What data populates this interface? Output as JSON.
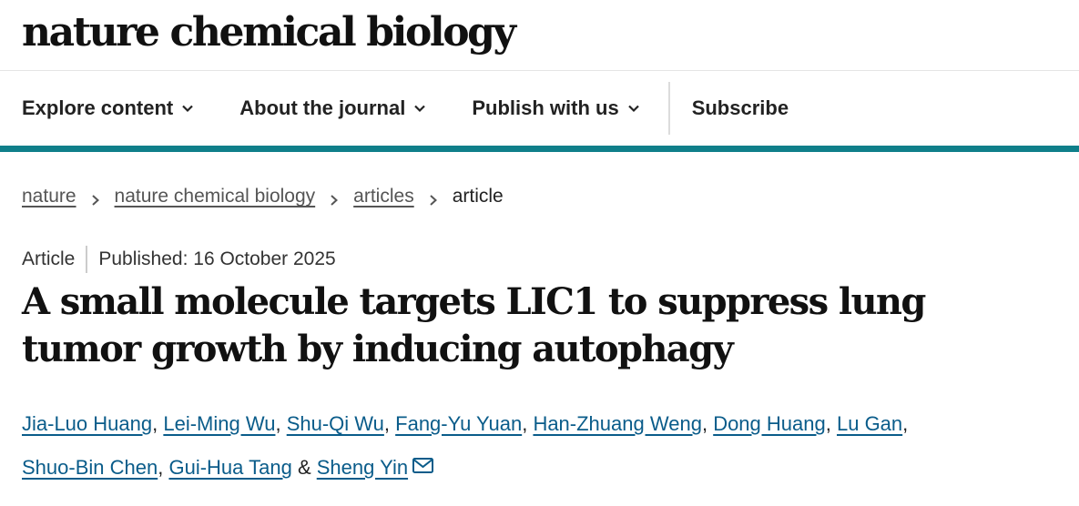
{
  "masthead": {
    "logo": "nature chemical biology"
  },
  "nav": {
    "items": [
      {
        "label": "Explore content",
        "icon": "chevron-down-icon"
      },
      {
        "label": "About the journal",
        "icon": "chevron-down-icon"
      },
      {
        "label": "Publish with us",
        "icon": "chevron-down-icon"
      }
    ],
    "subscribe": "Subscribe",
    "accent_color": "#0f7f8a"
  },
  "breadcrumb": {
    "items": [
      "nature",
      "nature chemical biology",
      "articles"
    ],
    "current": "article"
  },
  "article": {
    "type": "Article",
    "published": "Published: 16 October 2025",
    "title": "A small molecule targets LIC1 to suppress lung tumor growth by inducing autophagy",
    "authors": [
      "Jia-Luo Huang",
      "Lei-Ming Wu",
      "Shu-Qi Wu",
      "Fang-Yu Yuan",
      "Han-Zhuang Weng",
      "Dong Huang",
      "Lu Gan",
      "Shuo-Bin Chen",
      "Gui-Hua Tang",
      "Sheng Yin"
    ],
    "author_separator": ",",
    "last_joiner": "&",
    "contact_icon": "mail-icon"
  }
}
